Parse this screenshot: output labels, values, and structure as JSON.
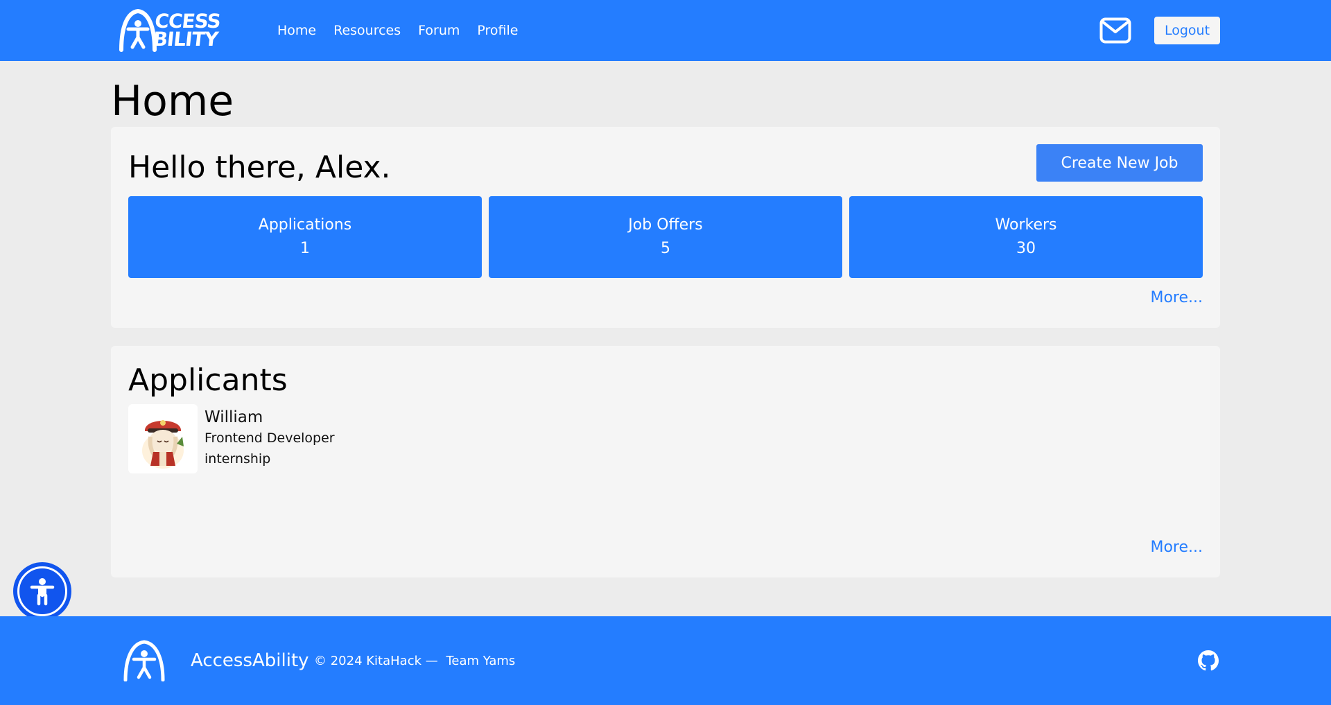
{
  "nav": {
    "logo_line1": "CCESS",
    "logo_line2": "BILITY",
    "links": [
      "Home",
      "Resources",
      "Forum",
      "Profile"
    ],
    "logout_label": "Logout"
  },
  "page": {
    "title": "Home"
  },
  "welcome": {
    "greeting": "Hello there, Alex.",
    "create_job_label": "Create New Job",
    "stats": [
      {
        "label": "Applications",
        "value": "1"
      },
      {
        "label": "Job Offers",
        "value": "5"
      },
      {
        "label": "Workers",
        "value": "30"
      }
    ],
    "more_label": "More..."
  },
  "applicants": {
    "title": "Applicants",
    "items": [
      {
        "name": "William",
        "job": "Frontend Developer internship"
      }
    ],
    "more_label": "More..."
  },
  "footer": {
    "brand": "AccessAbility",
    "copyright": "© 2024 KitaHack —",
    "team": "Team Yams"
  },
  "colors": {
    "primary": "#247dff",
    "button": "#3b82f6",
    "background": "#ececec",
    "card": "#f5f5f5",
    "a11y_button": "#1155ee"
  },
  "icons": {
    "mail": "mail-icon",
    "accessibility": "accessibility-icon",
    "github": "github-icon"
  }
}
